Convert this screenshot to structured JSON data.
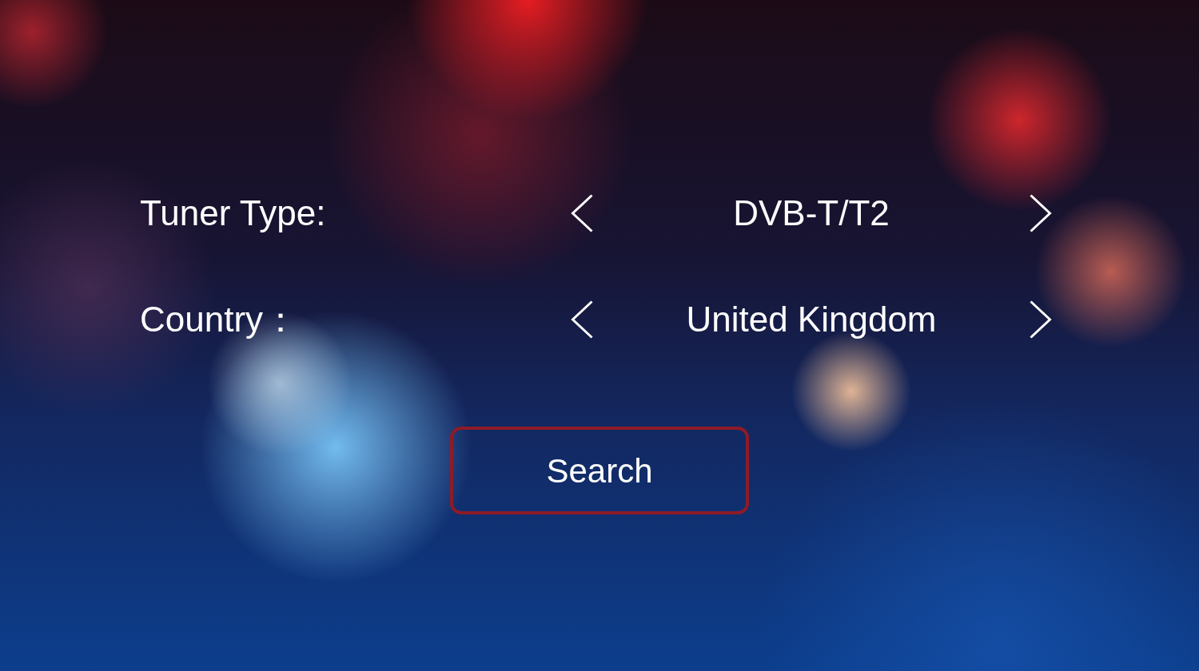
{
  "settings": [
    {
      "label": "Tuner Type:",
      "value": "DVB-T/T2"
    },
    {
      "label": "Country：",
      "value": "United Kingdom"
    }
  ],
  "search_button": {
    "label": "Search",
    "focused": true
  }
}
